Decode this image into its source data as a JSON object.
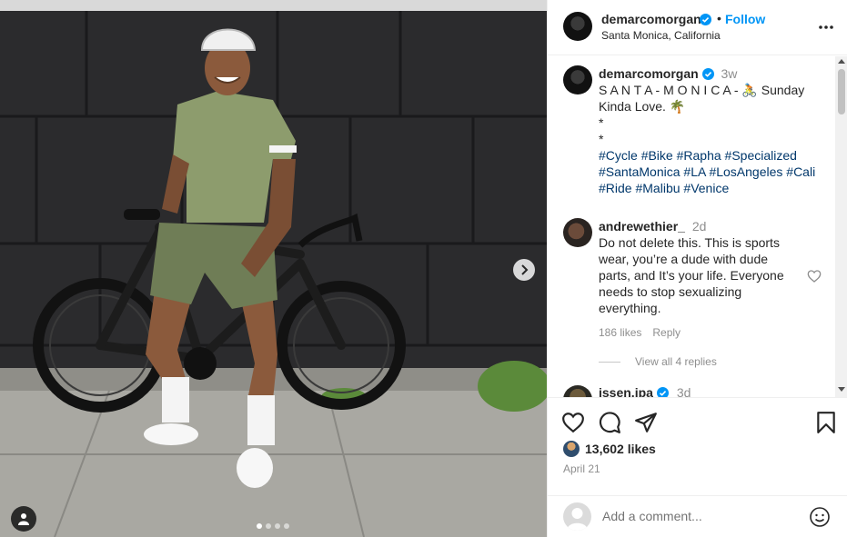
{
  "post": {
    "username": "demarcomorgan",
    "location": "Santa Monica, California",
    "follow_label": "Follow",
    "separator": "•",
    "carousel": {
      "total_slides": 4,
      "current_slide": 1
    }
  },
  "caption": {
    "username": "demarcomorgan",
    "time": "3w",
    "lines": [
      "S A N T A - M O N I C A - 🚴 Sunday",
      "Kinda Love. 🌴",
      "*",
      "*"
    ],
    "hashtag_lines": [
      [
        "#Cycle",
        "#Bike",
        "#Rapha",
        "#Specialized"
      ],
      [
        "#SantaMonica",
        "#LA",
        "#LosAngeles",
        "#Cali"
      ],
      [
        "#Ride",
        "#Malibu",
        "#Venice"
      ]
    ]
  },
  "comments": [
    {
      "username": "andrewethier_",
      "time": "2d",
      "text": "Do not delete this. This is sports wear, you’re a dude with dude parts, and It’s your life. Everyone needs to stop sexualizing everything.",
      "likes": "186 likes",
      "reply_label": "Reply",
      "view_replies": "View all 4 replies"
    },
    {
      "username": "issen.ipa",
      "time": "3d"
    }
  ],
  "actions": {
    "likes": "13,602 likes",
    "date": "April 21",
    "add_comment_placeholder": "Add a comment..."
  },
  "colors": {
    "link_blue": "#0095f6",
    "hashtag": "#00376b",
    "muted": "#8e8e8e",
    "verified": "#0095f6"
  },
  "icons": {
    "like": "heart-icon",
    "comment": "comment-icon",
    "share": "share-icon",
    "save": "bookmark-icon",
    "more": "more-icon",
    "next": "chevron-right-icon",
    "tags": "user-tag-icon",
    "emoji": "emoji-icon"
  }
}
